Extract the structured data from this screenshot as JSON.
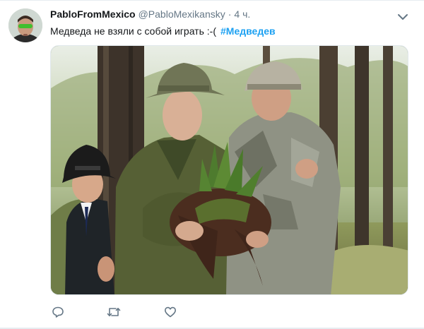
{
  "tweet": {
    "display_name": "PabloFromMexico",
    "handle": "@PabloMexikansky",
    "separator": "·",
    "timestamp": "4 ч.",
    "text": "Медведа не взяли с собой играть :-(",
    "hashtag": "#Медведев"
  },
  "icons": {
    "menu": "chevron-down-icon",
    "reply": "reply-icon",
    "retweet": "retweet-icon",
    "like": "heart-icon"
  },
  "colors": {
    "text": "#14171a",
    "secondary": "#657786",
    "link": "#1da1f2",
    "icon": "#657786",
    "divider": "#e6ecf0"
  }
}
